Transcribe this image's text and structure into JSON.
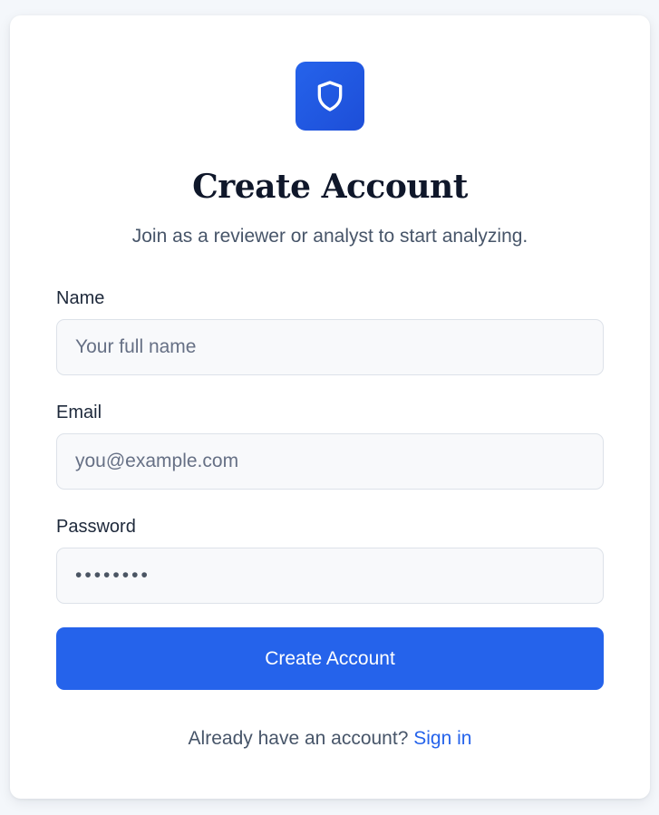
{
  "header": {
    "logo_icon": "shield-icon",
    "title": "Create Account",
    "subtitle": "Join as a reviewer or analyst to start analyzing."
  },
  "form": {
    "name": {
      "label": "Name",
      "placeholder": "Your full name",
      "value": ""
    },
    "email": {
      "label": "Email",
      "placeholder": "you@example.com",
      "value": ""
    },
    "password": {
      "label": "Password",
      "masked_value": "••••••••"
    },
    "submit_label": "Create Account"
  },
  "footer": {
    "prompt": "Already have an account?",
    "link_label": "Sign in"
  },
  "colors": {
    "accent": "#2563eb",
    "title_text": "#0f172a",
    "muted_text": "#475569",
    "page_background": "#f4f7fb",
    "input_background": "#f8f9fb",
    "input_border": "#dde2e9"
  }
}
